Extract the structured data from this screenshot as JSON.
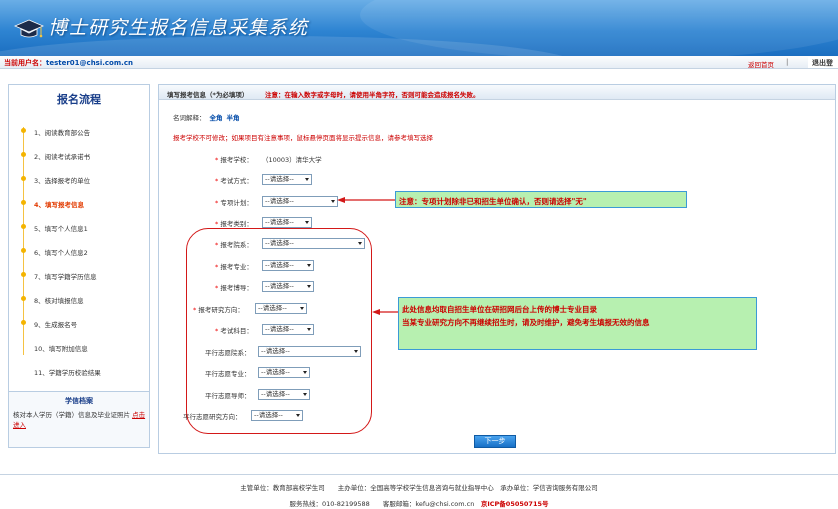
{
  "site": {
    "title": "博士研究生报名信息采集系统",
    "logo_icon": "graduation-cap-icon"
  },
  "userbar": {
    "user_label": "当前用户名：",
    "user_email": "tester01@chsi.com.cn",
    "home": "返回首页",
    "sep": "|",
    "logout": "退出登"
  },
  "sidebar": {
    "title": "报名流程",
    "steps": [
      {
        "label": "1、阅读教育部公告"
      },
      {
        "label": "2、阅读考试承诺书"
      },
      {
        "label": "3、选择报考的单位"
      },
      {
        "label": "4、填写报考信息"
      },
      {
        "label": "5、填写个人信息1"
      },
      {
        "label": "6、填写个人信息2"
      },
      {
        "label": "7、填写学籍学历信息"
      },
      {
        "label": "8、核对填报信息"
      },
      {
        "label": "9、生成报名号"
      },
      {
        "label": "10、填写附加信息"
      },
      {
        "label": "11、学籍学历校验结果"
      }
    ],
    "active_step": 3,
    "archive": {
      "title": "学信档案",
      "text": "核对本人学历（学籍）信息及毕业证照片",
      "link": "点击进入"
    }
  },
  "form": {
    "section_title": "填写报考信息（*为必填项）",
    "section_warning": "注意：在输入数字或字母时，请使用半角字符，否则可能会造成报名失败。",
    "charset_label": "名词解释：",
    "charset_full": "全角",
    "charset_half": "半角",
    "notice": "报考学校不可修改；如果项目有注意事项，鼠标悬停页面将显示提示信息，请参考填写选择",
    "fields": [
      {
        "label": "报考学校：",
        "required": true,
        "value": "（10003）清华大学"
      },
      {
        "label": "考试方式：",
        "required": true,
        "value": "--请选择--"
      },
      {
        "label": "专项计划：",
        "required": true,
        "value": "--请选择--"
      },
      {
        "label": "报考类别：",
        "required": true,
        "value": "--请选择--"
      },
      {
        "label": "报考院系：",
        "required": true,
        "value": "--请选择--"
      },
      {
        "label": "报考专业：",
        "required": true,
        "value": "--请选择--"
      },
      {
        "label": "报考博导：",
        "required": true,
        "value": "--请选择--"
      },
      {
        "label": "报考研究方向：",
        "required": true,
        "value": "--请选择--"
      },
      {
        "label": "考试科目：",
        "required": true,
        "value": "--请选择--"
      },
      {
        "label": "平行志愿院系：",
        "required": false,
        "value": "--请选择--"
      },
      {
        "label": "平行志愿专业：",
        "required": false,
        "value": "--请选择--"
      },
      {
        "label": "平行志愿导师：",
        "required": false,
        "value": "--请选择--"
      },
      {
        "label": "平行志愿研究方向：",
        "required": false,
        "value": "--请选择--"
      }
    ],
    "next_button": "下一步"
  },
  "annotations": {
    "note1": "注意：专项计划除非已和招生单位确认，否则请选择\"无\"",
    "note2_line1": "此处信息均取自招生单位在研招网后台上传的博士专业目录",
    "note2_line2": "当某专业研究方向不再继续招生时，请及时维护，避免考生填报无效的信息"
  },
  "footer": {
    "line1": "主管单位：教育部高校学生司　　主办单位：全国高等学校学生信息咨询与就业指导中心　承办单位：学信咨询服务有限公司",
    "line2": "服务热线：010-82199588　　客服邮箱：kefu@chsi.com.cn",
    "icp": "京ICP备05050715号"
  },
  "colors": {
    "accent": "#2e84d2",
    "warning": "#cc0000",
    "annotation_bg": "#b7f0b0",
    "step_dot": "#f4b400"
  }
}
